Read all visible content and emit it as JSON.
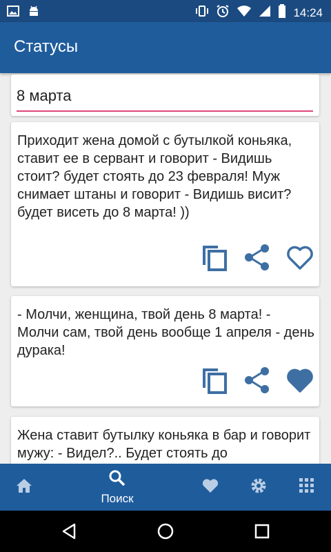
{
  "status_bar": {
    "time": "14:24",
    "icons": [
      "image-icon",
      "android-icon",
      "vibrate-icon",
      "alarm-icon",
      "wifi-icon",
      "signal-icon",
      "battery-icon"
    ]
  },
  "app_bar": {
    "title": "Статусы"
  },
  "search": {
    "value": "8 марта"
  },
  "cards": [
    {
      "text": "Приходит жена домой с бутылкой коньяка, ставит ее в сервант и говорит - Видишь стоит? будет стоять до 23 февраля! Муж снимает штаны и говорит - Видишь висит? будет висеть до 8 марта! ))",
      "favorited": false
    },
    {
      "text": "- Молчи, женщина, твой день 8 марта! - Молчи сам, твой день вообще 1 апреля - день дурака!",
      "favorited": true
    },
    {
      "text": "Жена ставит бутылку коньяка в бар и говорит мужу: - Видел?.. Будет стоять до",
      "favorited": false
    }
  ],
  "bottom_nav": {
    "items": [
      {
        "icon": "home-icon",
        "label": ""
      },
      {
        "icon": "search-icon",
        "label": "Поиск"
      },
      {
        "icon": "heart-icon",
        "label": ""
      },
      {
        "icon": "gear-icon",
        "label": ""
      },
      {
        "icon": "grid-icon",
        "label": ""
      }
    ]
  },
  "colors": {
    "primary": "#1f5c9c",
    "status_bar": "#1b4a80",
    "accent": "#e0457b",
    "icon_blue": "#3e6fa3"
  }
}
